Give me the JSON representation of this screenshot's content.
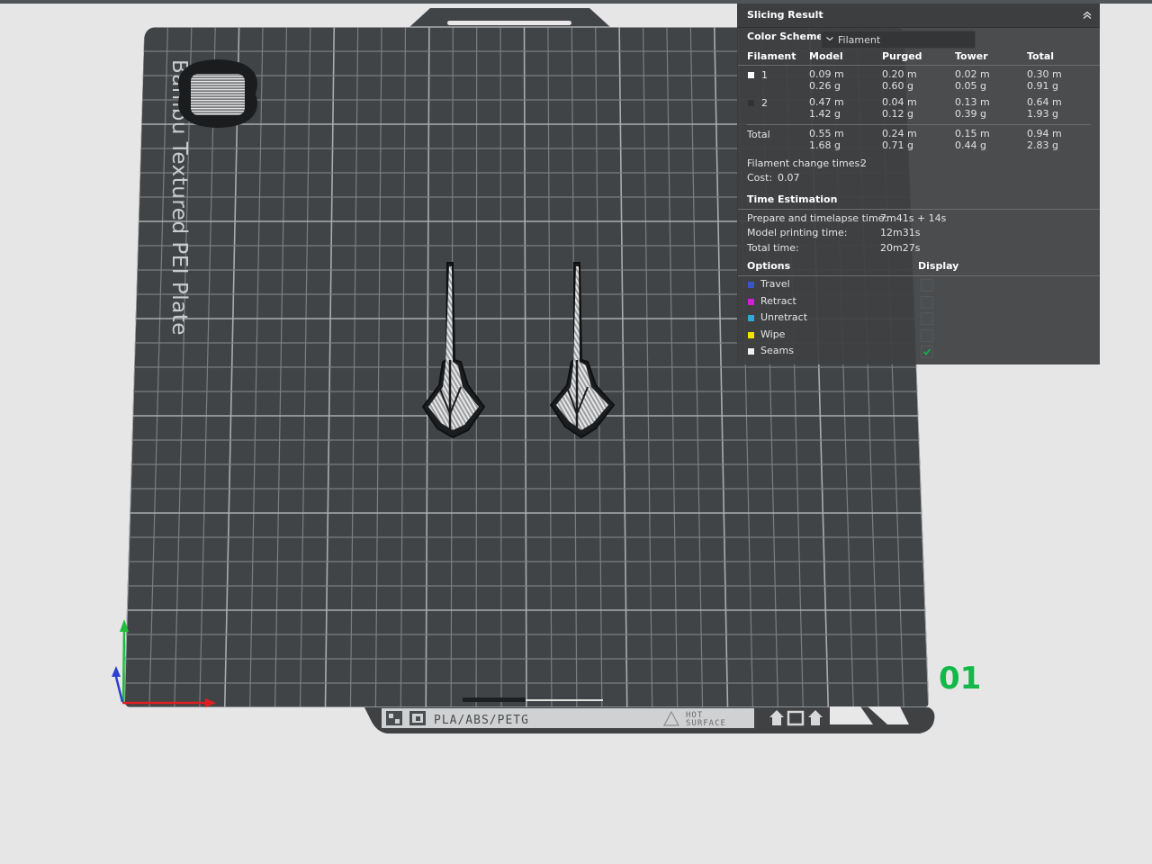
{
  "viewport": {
    "plate_label": "Bambu Textured PEI Plate",
    "plate_number": "01",
    "strip_text": "PLA/ABS/PETG",
    "hot_surface_line1": "HOT",
    "hot_surface_line2": "SURFACE"
  },
  "panel": {
    "title": "Slicing Result",
    "color_scheme_label": "Color Scheme",
    "color_scheme_value": "Filament",
    "table": {
      "headers": [
        "Filament",
        "Model",
        "Purged",
        "Tower",
        "Total"
      ],
      "rows": [
        {
          "id": "1",
          "color": "#ffffff",
          "model": [
            "0.09 m",
            "0.26 g"
          ],
          "purged": [
            "0.20 m",
            "0.60 g"
          ],
          "tower": [
            "0.02 m",
            "0.05 g"
          ],
          "total": [
            "0.30 m",
            "0.91 g"
          ]
        },
        {
          "id": "2",
          "color": "#303234",
          "model": [
            "0.47 m",
            "1.42 g"
          ],
          "purged": [
            "0.04 m",
            "0.12 g"
          ],
          "tower": [
            "0.13 m",
            "0.39 g"
          ],
          "total": [
            "0.64 m",
            "1.93 g"
          ]
        }
      ],
      "total_row": {
        "label": "Total",
        "model": [
          "0.55 m",
          "1.68 g"
        ],
        "purged": [
          "0.24 m",
          "0.71 g"
        ],
        "tower": [
          "0.15 m",
          "0.44 g"
        ],
        "total": [
          "0.94 m",
          "2.83 g"
        ]
      }
    },
    "filament_change_label": "Filament change times:",
    "filament_change_value": "2",
    "cost_label": "Cost:",
    "cost_value": "0.07",
    "time_estimation_title": "Time Estimation",
    "times": [
      {
        "label": "Prepare and timelapse time:",
        "value": "7m41s + 14s"
      },
      {
        "label": "Model printing time:",
        "value": "12m31s"
      },
      {
        "label": "Total time:",
        "value": "20m27s"
      }
    ],
    "options_title": "Options",
    "display_title": "Display",
    "options": [
      {
        "label": "Travel",
        "color": "#3a55c8",
        "checked": false
      },
      {
        "label": "Retract",
        "color": "#d21fd2",
        "checked": false
      },
      {
        "label": "Unretract",
        "color": "#2fa8d8",
        "checked": false
      },
      {
        "label": "Wipe",
        "color": "#f5e400",
        "checked": false
      },
      {
        "label": "Seams",
        "color": "#f0f0f0",
        "checked": true
      }
    ]
  }
}
